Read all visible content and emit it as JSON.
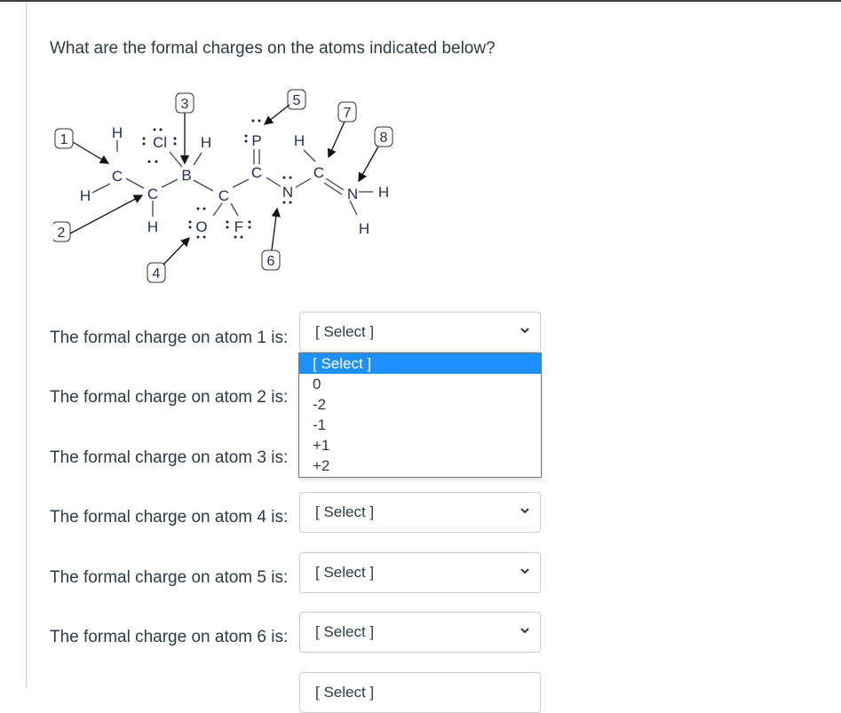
{
  "question": "What are the formal charges on the atoms indicated below?",
  "molecule": {
    "labels": [
      "1",
      "2",
      "3",
      "4",
      "5",
      "6",
      "7",
      "8"
    ],
    "atoms": {
      "H": "H",
      "C": "C",
      "B": "B",
      "Cl": "Cl",
      "O": "O",
      "F": "F",
      "P": "P",
      "N": "N"
    }
  },
  "rows": [
    {
      "label": "The formal charge on atom 1 is:",
      "value": "[ Select ]",
      "open": true
    },
    {
      "label": "The formal charge on atom 2 is:",
      "value": "[ Select ]"
    },
    {
      "label": "The formal charge on atom 3 is:",
      "value": "[ Select ]"
    },
    {
      "label": "The formal charge on atom 4 is:",
      "value": "[ Select ]"
    },
    {
      "label": "The formal charge on atom 5 is:",
      "value": "[ Select ]"
    },
    {
      "label": "The formal charge on atom 6 is:",
      "value": "[ Select ]"
    },
    {
      "label": "",
      "value": "[ Select ]"
    }
  ],
  "dropdown_options": [
    "[ Select ]",
    "0",
    "-2",
    "-1",
    "+1",
    "+2"
  ],
  "dropdown_selected_index": 0,
  "colors": {
    "highlight": "#1e90ff",
    "text": "#2d3b45",
    "border": "#c7cdd1"
  }
}
